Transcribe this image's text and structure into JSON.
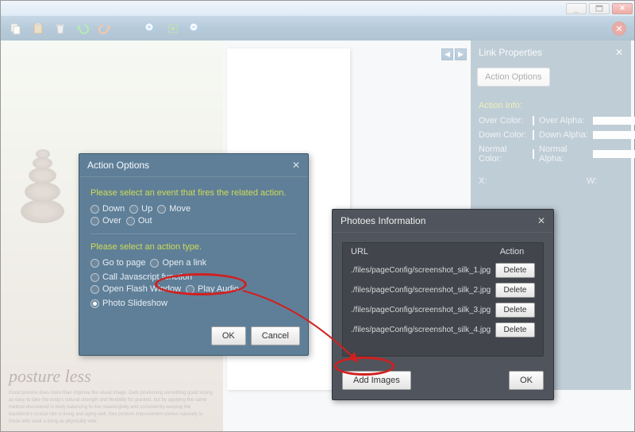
{
  "window": {
    "controls": {
      "min": "_",
      "max": "▢",
      "close": "✕"
    }
  },
  "link_panel": {
    "title": "Link Properties",
    "action_options_btn": "Action Options",
    "section_label": "Action Info:",
    "over_color": "Over Color:",
    "down_color": "Down Color:",
    "normal_color": "Normal Color:",
    "over_alpha": "Over Alpha:",
    "down_alpha": "Down Alpha:",
    "normal_alpha": "Normal Alpha:",
    "x_label": "X:",
    "w_label": "W:"
  },
  "action_dialog": {
    "title": "Action Options",
    "prompt_event": "Please select an event that fires the related action.",
    "events": [
      "Down",
      "Up",
      "Move",
      "Over",
      "Out"
    ],
    "prompt_type": "Please select an action type.",
    "types": [
      "Go to page",
      "Open a link",
      "Call Javascript function",
      "Open Flash Window",
      "Play Audio",
      "Photo Slideshow"
    ],
    "ok": "OK",
    "cancel": "Cancel"
  },
  "photos_dialog": {
    "title": "Photoes Information",
    "col_url": "URL",
    "col_action": "Action",
    "rows": [
      "./files/pageConfig/screenshot_silk_1.jpg",
      "./files/pageConfig/screenshot_silk_2.jpg",
      "./files/pageConfig/screenshot_silk_3.jpg",
      "./files/pageConfig/screenshot_silk_4.jpg"
    ],
    "delete": "Delete",
    "add_images": "Add Images",
    "ok": "OK"
  },
  "page": {
    "posture": "posture less",
    "body_text": "Good posture does more than improve the visual image. Dark positioning something good strong as easy to take the body's natural strength and flexibility for granted, but by applying the same method discovered in body balancing to live meaningfully and consistently keeping the backbone's crucial role in living and aging well. Key posture improvement comes naturally to those who seek a living as physically vital."
  }
}
